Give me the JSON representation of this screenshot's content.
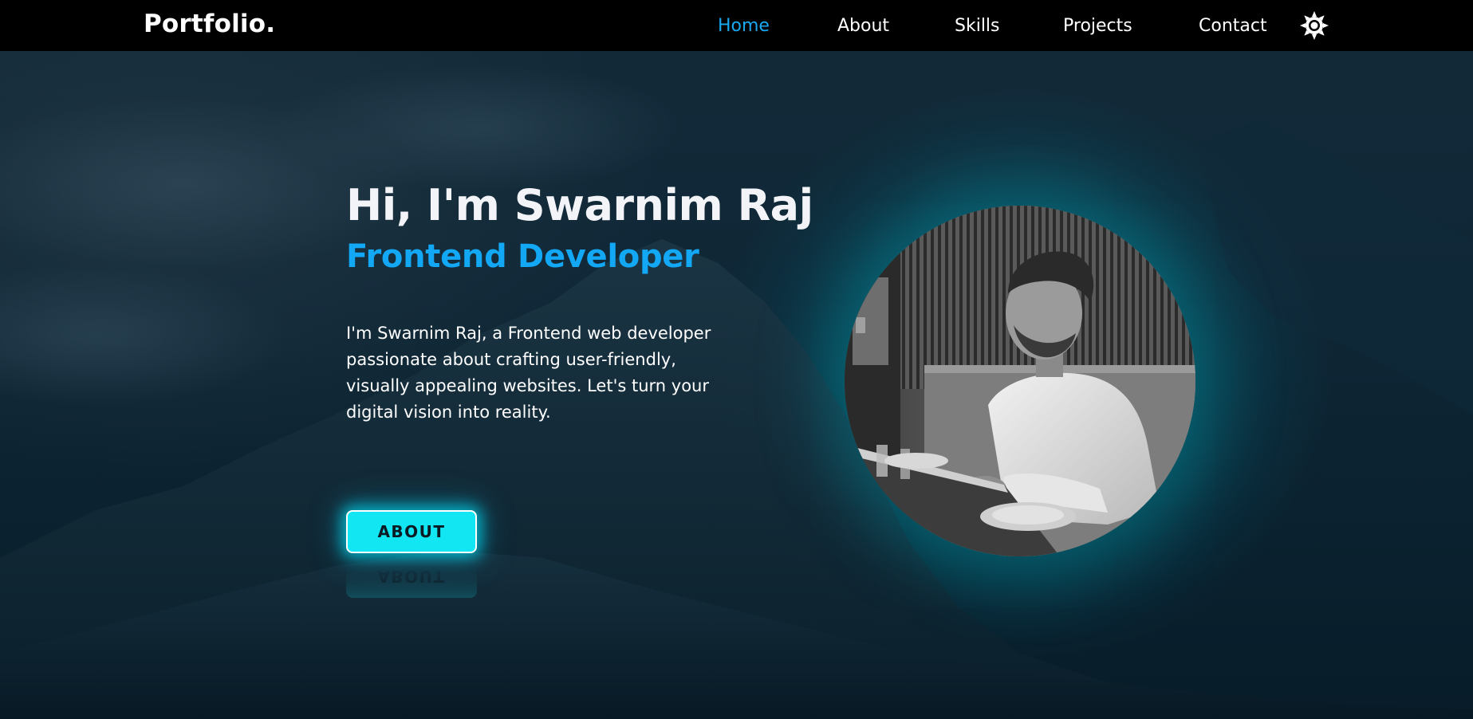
{
  "navbar": {
    "logo": "Portfolio.",
    "links": [
      {
        "label": "Home",
        "active": true
      },
      {
        "label": "About",
        "active": false
      },
      {
        "label": "Skills",
        "active": false
      },
      {
        "label": "Projects",
        "active": false
      },
      {
        "label": "Contact",
        "active": false
      }
    ],
    "theme_toggle_icon": "sun-icon"
  },
  "hero": {
    "title": "Hi, I'm Swarnim Raj",
    "role": "Frontend Developer",
    "description": "I'm Swarnim Raj, a Frontend web developer passionate about crafting user-friendly, visually appealing websites. Let's turn your digital vision into reality.",
    "button_label": "ABOUT"
  },
  "profile_image": {
    "icon": "profile-photo"
  },
  "colors": {
    "accent": "#12a8f5",
    "button": "#11e6f2",
    "navbar_bg": "#000000",
    "hero_bg": "#0c2230",
    "glow": "#00aab9"
  }
}
